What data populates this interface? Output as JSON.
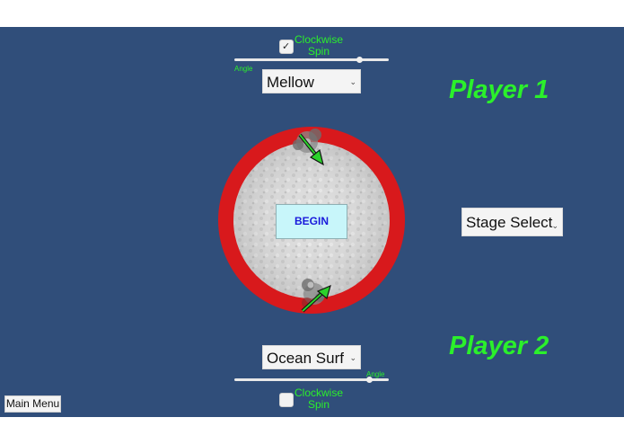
{
  "player1": {
    "label": "Player 1",
    "spin_label": "Clockwise Spin",
    "spin_checked": true,
    "angle_label": "Angle",
    "angle_value": 0.82,
    "top_selected": "Mellow"
  },
  "player2": {
    "label": "Player 2",
    "spin_label": "Clockwise Spin",
    "spin_checked": false,
    "angle_label": "Angle",
    "angle_value": 0.88,
    "top_selected": "Ocean Surf"
  },
  "stage_select": "Stage Select",
  "begin_label": "BEGIN",
  "main_menu_label": "Main Menu",
  "colors": {
    "background": "#304e7a",
    "arena_ring": "#d8191c",
    "arena_floor": "#dcdcdc",
    "player_text": "#2bf02b",
    "begin_bg": "#c8f6fa",
    "begin_text": "#1a1adb",
    "arrow": "#2bd12b"
  },
  "icons": {
    "check": "check-icon",
    "dropdown": "chevron-down-icon",
    "spinning_top": "spinning-top-icon",
    "direction": "arrow-icon"
  }
}
